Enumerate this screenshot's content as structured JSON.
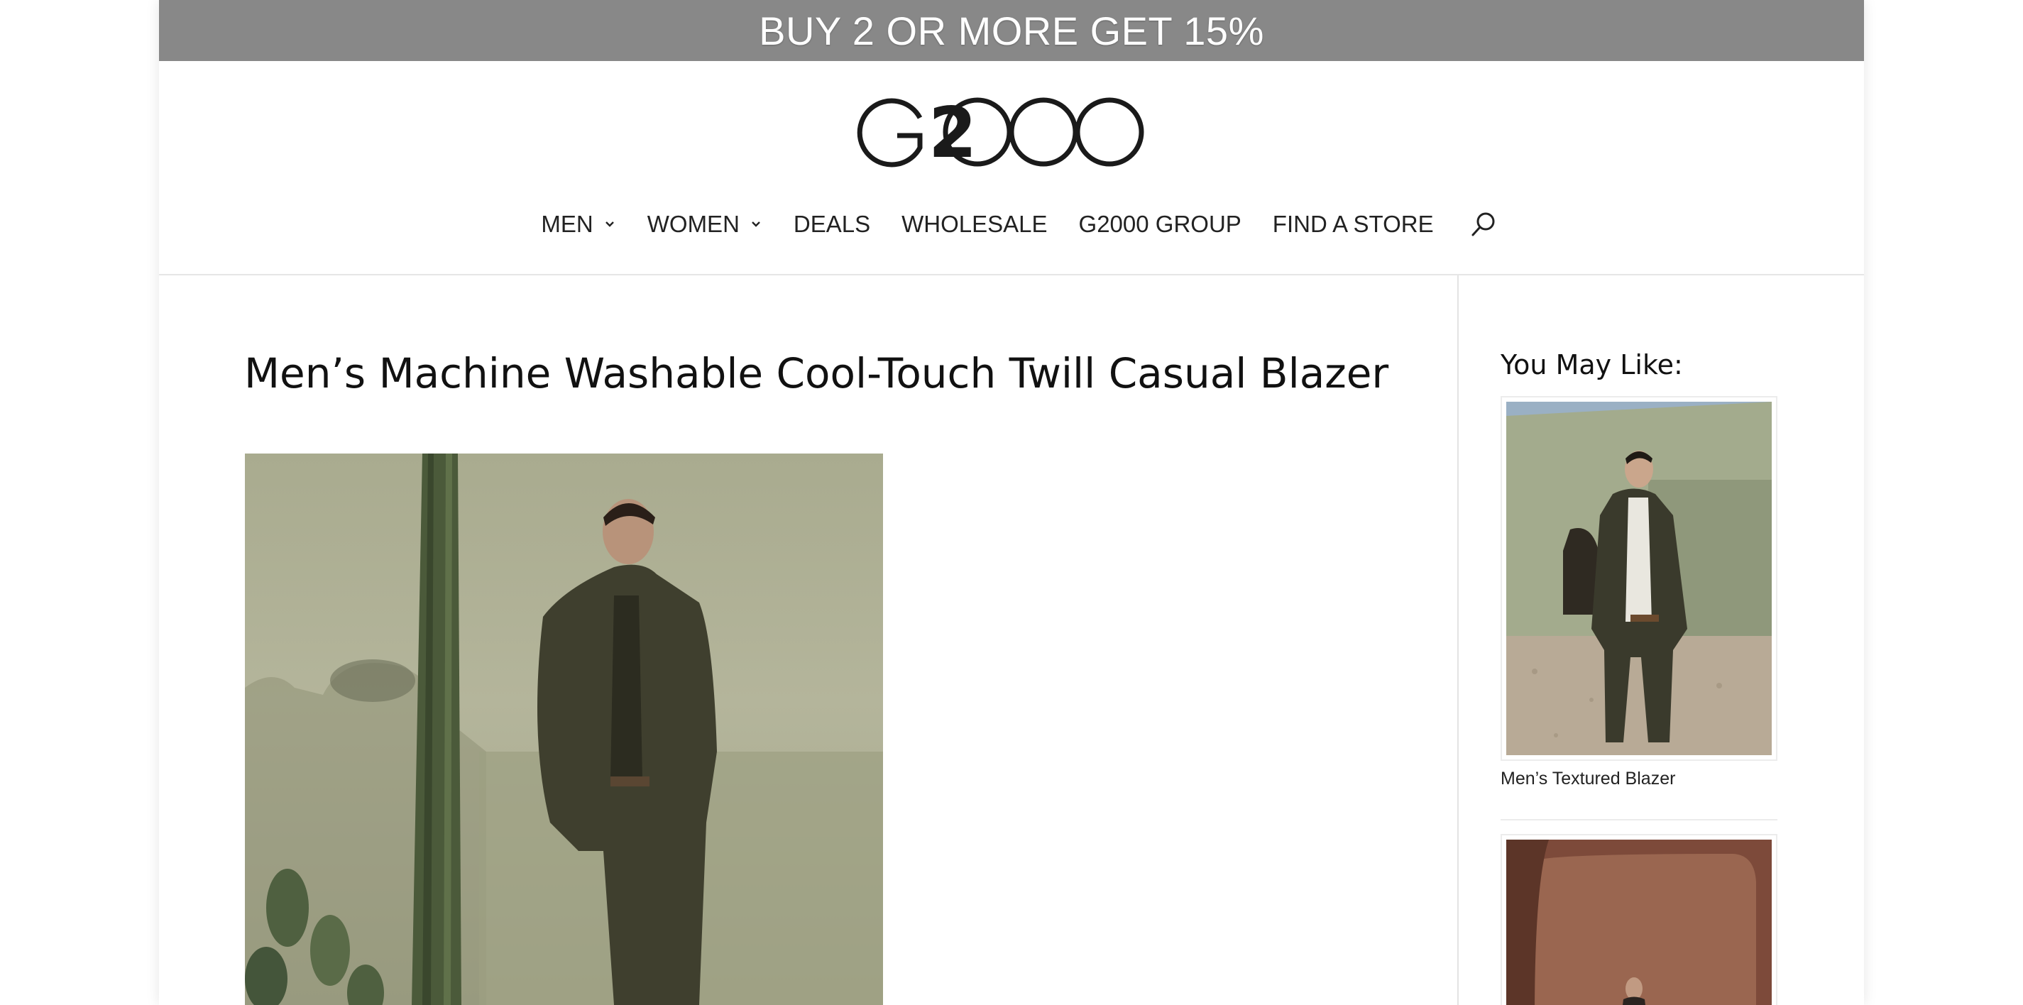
{
  "promo": {
    "text": "BUY 2 OR MORE GET 15%"
  },
  "brand": {
    "logo_text": "G2000"
  },
  "nav": {
    "items": [
      {
        "label": "MEN",
        "has_dropdown": true
      },
      {
        "label": "WOMEN",
        "has_dropdown": true
      },
      {
        "label": "DEALS",
        "has_dropdown": false
      },
      {
        "label": "WHOLESALE",
        "has_dropdown": false
      },
      {
        "label": "G2000 GROUP",
        "has_dropdown": false
      },
      {
        "label": "FIND A STORE",
        "has_dropdown": false
      }
    ],
    "search_icon": "search-icon"
  },
  "product": {
    "title": "Men’s Machine Washable Cool-Touch Twill Casual Blazer"
  },
  "sidebar": {
    "heading": "You May Like:",
    "items": [
      {
        "name": "Men’s Textured Blazer"
      },
      {
        "name": ""
      }
    ]
  },
  "colors": {
    "promo_bg": "#888888",
    "promo_text": "#ffffff",
    "text": "#111111",
    "divider": "#e3e3e3",
    "photo_sage": "#a9ab8f",
    "photo_terracotta": "#9a6650"
  }
}
